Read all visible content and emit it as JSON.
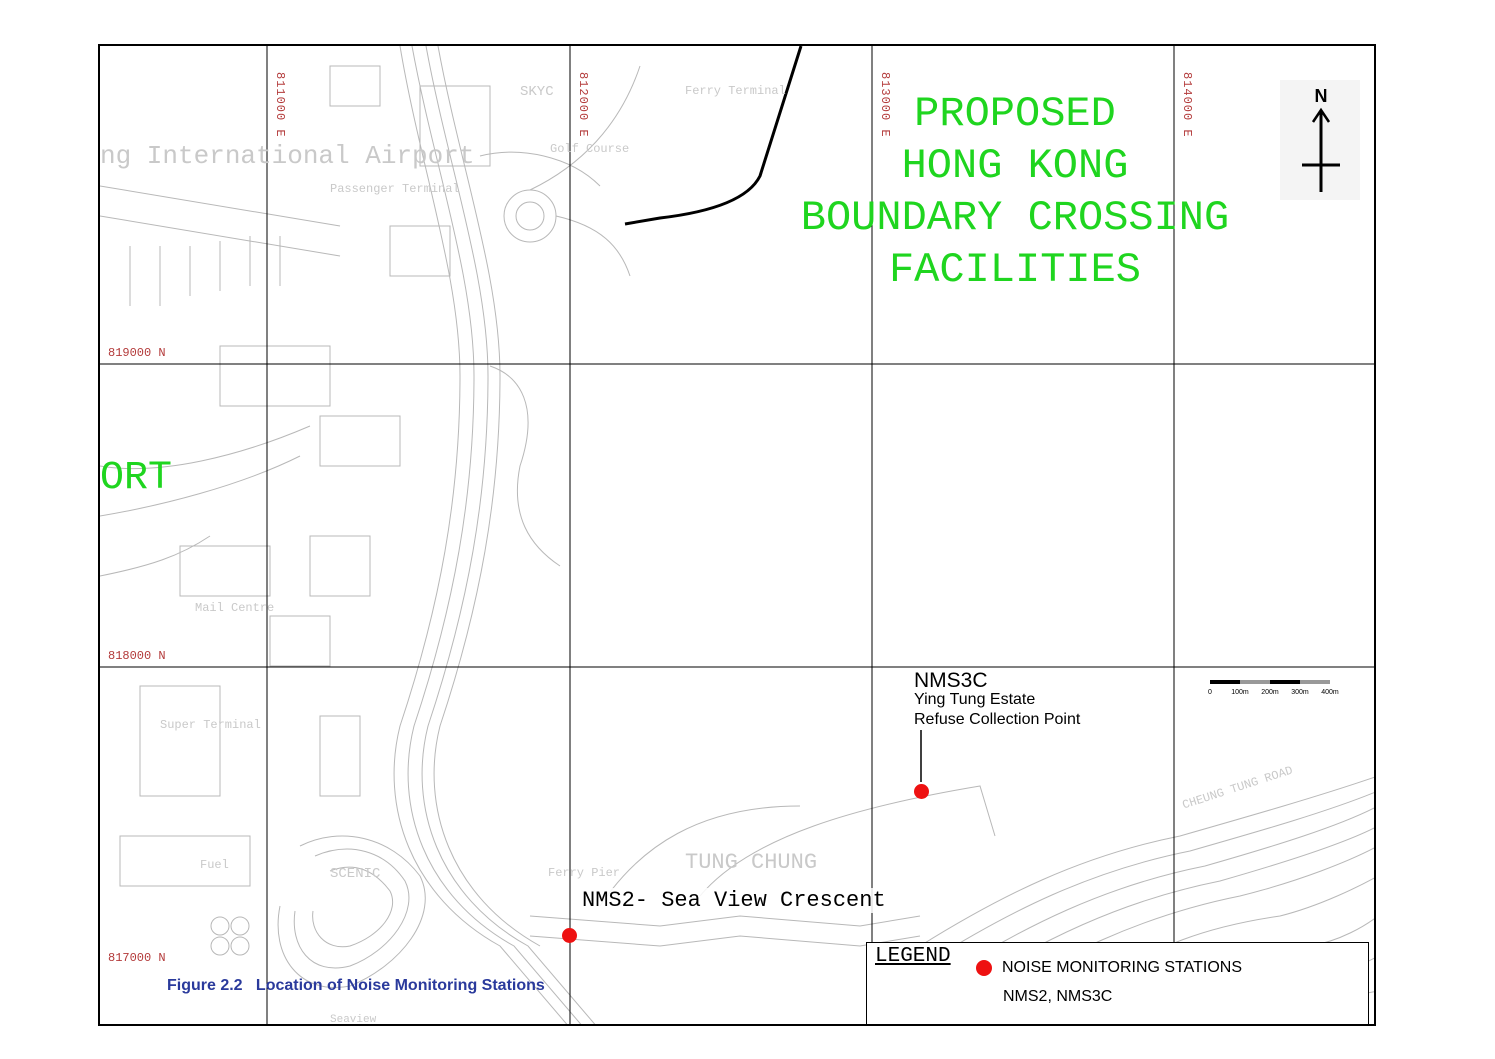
{
  "grid": {
    "eastings": [
      "811000 E",
      "812000 E",
      "813000 E",
      "814000 E"
    ],
    "northings": [
      "819000 N",
      "818000 N",
      "817000 N"
    ]
  },
  "boundary_crossing": {
    "label": "PROPOSED\nHONG KONG\nBOUNDARY CROSSING\nFACILITIES",
    "label_color": "#1fd51f",
    "outline_color": "#000000"
  },
  "airport_label_fragment": "ORT",
  "basemap_labels": {
    "international_airport": "ng International Airport",
    "passenger_terminal": "Passenger Terminal",
    "skycity": "SKYC",
    "ferry_terminal": "Ferry Terminal",
    "golf_course": "Golf Course",
    "mail_centre": "Mail Centre",
    "super_terminal": "Super Terminal",
    "fuel": "Fuel",
    "scenic": "SCENIC",
    "tung_chung": "TUNG CHUNG",
    "ferry_pier": "Ferry Pier",
    "cheung_tung_road": "CHEUNG TUNG ROAD",
    "sea_view": "Seaview"
  },
  "stations": [
    {
      "id": "NMS3C",
      "title": "NMS3C",
      "line1": "Ying Tung Estate",
      "line2": "Refuse Collection Point"
    },
    {
      "id": "NMS2",
      "label": "NMS2- Sea View Crescent"
    }
  ],
  "station_color": "#ee1111",
  "north_arrow": {
    "letter": "N"
  },
  "scale_bar": {
    "ticks": [
      "0",
      "100m",
      "200m",
      "300m",
      "400m"
    ]
  },
  "figure_caption": "Figure 2.2   Location of Noise Monitoring Stations",
  "caption_color": "#2a3a9c",
  "legend": {
    "title": "LEGEND",
    "item_label": "NOISE MONITORING STATIONS",
    "item_sub": "NMS2, NMS3C"
  }
}
